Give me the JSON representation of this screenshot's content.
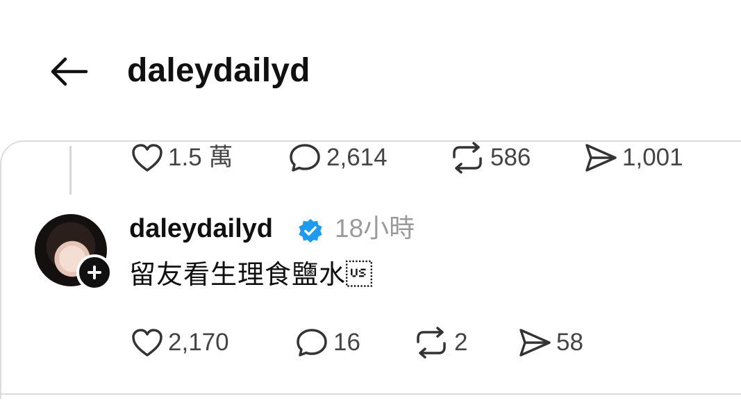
{
  "header": {
    "back_icon": "arrow-left-icon",
    "title": "daleydailyd"
  },
  "previous_post": {
    "likes": "1.5 萬",
    "comments": "2,614",
    "reposts": "586",
    "shares": "1,001"
  },
  "post": {
    "username": "daleydailyd",
    "verified": true,
    "time": "18小時",
    "text": "留友看生理食鹽水\u001f",
    "likes": "2,170",
    "comments": "16",
    "reposts": "2",
    "shares": "58"
  },
  "colors": {
    "verified": "#1d9bf0",
    "muted_text": "#9a9a9a",
    "divider": "#dcdcdc"
  }
}
